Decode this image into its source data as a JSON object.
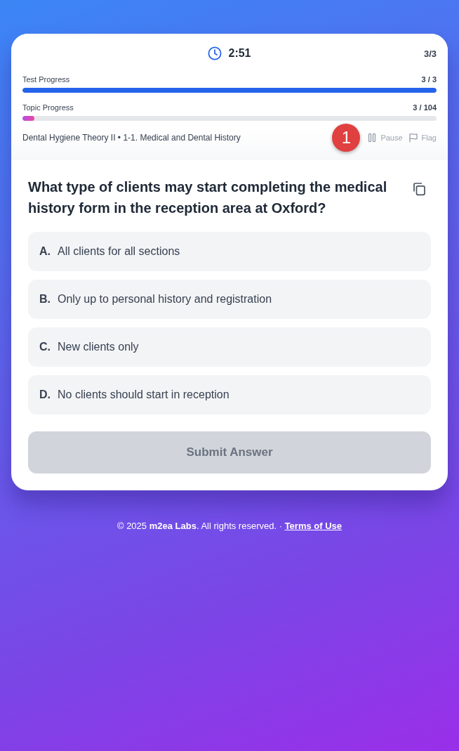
{
  "timer": {
    "time": "2:51"
  },
  "question_counter": "3/3",
  "progress": [
    {
      "kind": "test",
      "label": "Test Progress",
      "reading": "3 / 3",
      "level": 1
    },
    {
      "kind": "topic",
      "label": "Topic Progress",
      "reading": "3 / 104",
      "level": 0.029
    }
  ],
  "breadcrumb": "Dental Hygiene Theory II • 1-1. Medical and Dental History",
  "badge": "1",
  "actions": [
    {
      "kind": "pause",
      "label": "Pause"
    },
    {
      "kind": "flag",
      "label": "Flag"
    }
  ],
  "question": "What type of clients may start completing the medical history form in the reception area at Oxford?",
  "options": [
    {
      "letter": "A.",
      "text": "All clients for all sections",
      "selected": false
    },
    {
      "letter": "B.",
      "text": "Only up to personal history and registration",
      "selected": false
    },
    {
      "letter": "C.",
      "text": "New clients only",
      "selected": false
    },
    {
      "letter": "D.",
      "text": "No clients should start in reception",
      "selected": false
    }
  ],
  "submit": {
    "label": "Submit Answer",
    "disabled": true
  },
  "footer": {
    "text": "© 2025 **m2ea Labs**. All rights reserved. ·",
    "link": "Terms of Use"
  }
}
